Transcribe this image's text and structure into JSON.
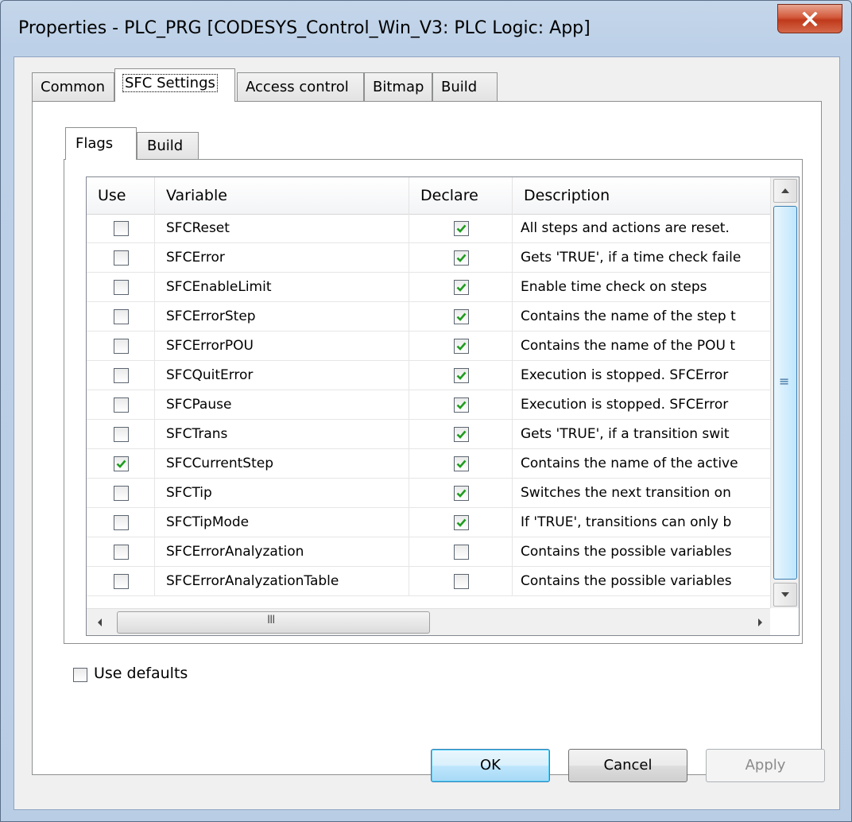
{
  "window": {
    "title": "Properties - PLC_PRG [CODESYS_Control_Win_V3: PLC Logic: App]"
  },
  "tabs": [
    {
      "label": "Common",
      "active": false
    },
    {
      "label": "SFC Settings",
      "active": true
    },
    {
      "label": "Access control",
      "active": false
    },
    {
      "label": "Bitmap",
      "active": false
    },
    {
      "label": "Build",
      "active": false
    }
  ],
  "subtabs": [
    {
      "label": "Flags",
      "active": true
    },
    {
      "label": "Build",
      "active": false
    }
  ],
  "grid": {
    "headers": {
      "use": "Use",
      "variable": "Variable",
      "declare": "Declare",
      "description": "Description"
    },
    "rows": [
      {
        "use": false,
        "variable": "SFCReset",
        "declare": true,
        "description": "All steps and actions are reset."
      },
      {
        "use": false,
        "variable": "SFCError",
        "declare": true,
        "description": "Gets 'TRUE', if a time check faile"
      },
      {
        "use": false,
        "variable": "SFCEnableLimit",
        "declare": true,
        "description": "Enable time check on steps"
      },
      {
        "use": false,
        "variable": "SFCErrorStep",
        "declare": true,
        "description": "Contains the name of the step t"
      },
      {
        "use": false,
        "variable": "SFCErrorPOU",
        "declare": true,
        "description": "Contains the name of the POU t"
      },
      {
        "use": false,
        "variable": "SFCQuitError",
        "declare": true,
        "description": "Execution is stopped. SFCError"
      },
      {
        "use": false,
        "variable": "SFCPause",
        "declare": true,
        "description": "Execution is stopped. SFCError"
      },
      {
        "use": false,
        "variable": "SFCTrans",
        "declare": true,
        "description": "Gets 'TRUE', if a transition swit"
      },
      {
        "use": true,
        "variable": "SFCCurrentStep",
        "declare": true,
        "description": "Contains the name of the active"
      },
      {
        "use": false,
        "variable": "SFCTip",
        "declare": true,
        "description": "Switches the next transition on"
      },
      {
        "use": false,
        "variable": "SFCTipMode",
        "declare": true,
        "description": "If 'TRUE', transitions can only b"
      },
      {
        "use": false,
        "variable": "SFCErrorAnalyzation",
        "declare": false,
        "description": "Contains the possible variables"
      },
      {
        "use": false,
        "variable": "SFCErrorAnalyzationTable",
        "declare": false,
        "description": "Contains the possible variables"
      }
    ],
    "hscroll_grip": "III",
    "vscroll_grip": "≡"
  },
  "use_defaults": {
    "label": "Use defaults",
    "checked": false
  },
  "buttons": {
    "ok": "OK",
    "cancel": "Cancel",
    "apply": "Apply"
  },
  "colors": {
    "check": "#1f9c1f",
    "accent": "#3c7fb1",
    "close": "#c0391b"
  }
}
